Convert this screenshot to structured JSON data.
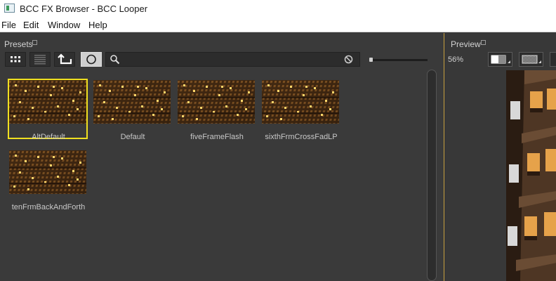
{
  "window": {
    "title": "BCC FX Browser - BCC Looper"
  },
  "menu": [
    "File",
    "Edit",
    "Window",
    "Help"
  ],
  "presets_panel": {
    "tab_label": "Presets",
    "items": [
      {
        "label": "AltDefault",
        "selected": true
      },
      {
        "label": "Default"
      },
      {
        "label": "fiveFrameFlash"
      },
      {
        "label": "sixthFrmCrossFadLP"
      },
      {
        "label": "tenFrmBackAndForth"
      }
    ]
  },
  "preview_panel": {
    "tab_label": "Preview",
    "zoom": "56%"
  },
  "colors": {
    "selection": "#f0e020",
    "panel_border": "#c8a040",
    "background": "#3a3a3a"
  },
  "icons": [
    "grid-view-icon",
    "list-view-icon",
    "up-folder-icon",
    "circle-icon",
    "search-icon",
    "clear-icon",
    "compare-icon",
    "checker-icon"
  ]
}
